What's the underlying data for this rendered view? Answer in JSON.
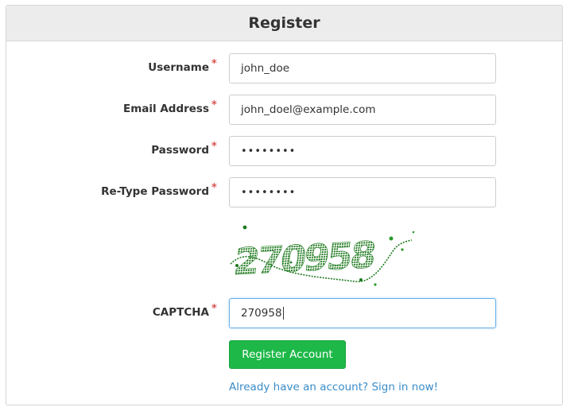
{
  "header": {
    "title": "Register"
  },
  "form": {
    "required_mark": "*",
    "fields": {
      "username": {
        "label": "Username",
        "value": "john_doe"
      },
      "email": {
        "label": "Email Address",
        "value": "john_doel@example.com"
      },
      "password": {
        "label": "Password",
        "value": "••••••••"
      },
      "retype_password": {
        "label": "Re-Type Password",
        "value": "••••••••"
      },
      "captcha": {
        "label": "CAPTCHA",
        "value": "270958"
      }
    },
    "captcha_image_text": "270958",
    "submit_label": "Register Account",
    "signin_link": "Already have an account? Sign in now!"
  },
  "colors": {
    "accent_button": "#1eb848",
    "link": "#3a8cc8",
    "required": "#d9534f",
    "captcha_ink": "#1e7a1e"
  }
}
